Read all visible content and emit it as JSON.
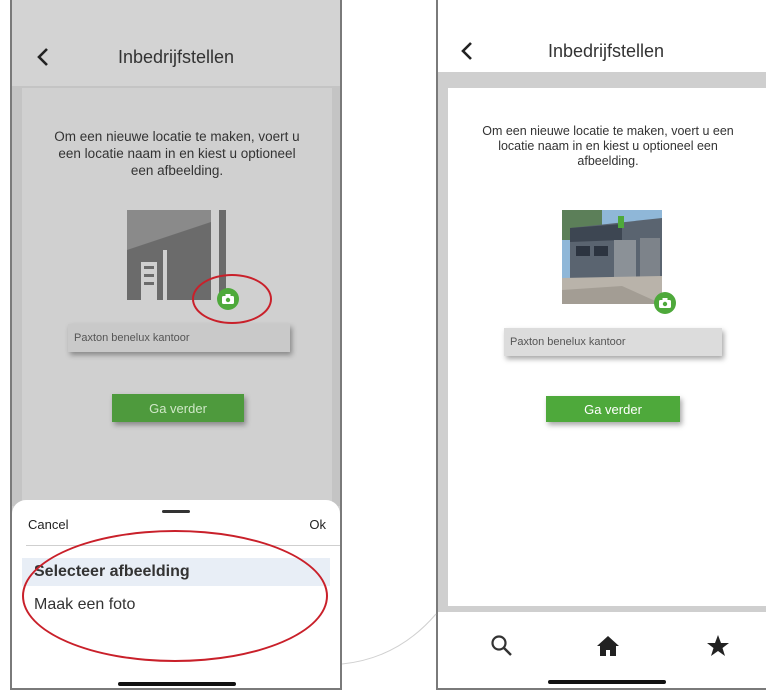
{
  "screen_title": "Inbedrijfstellen",
  "intro_text": "Om een nieuwe locatie te maken, voert u een locatie naam in en kiest u optioneel een afbeelding.",
  "location_name": "Paxton benelux kantoor",
  "continue_label": "Ga verder",
  "sheet": {
    "cancel_label": "Cancel",
    "ok_label": "Ok",
    "options": [
      "Selecteer afbeelding",
      "Maak een foto"
    ]
  },
  "tabs": [
    "search-icon",
    "home-icon",
    "star-icon"
  ],
  "colors": {
    "accent": "#4ea93b",
    "highlight_ring": "#c9202a",
    "overlay": "#cfcfcf"
  }
}
